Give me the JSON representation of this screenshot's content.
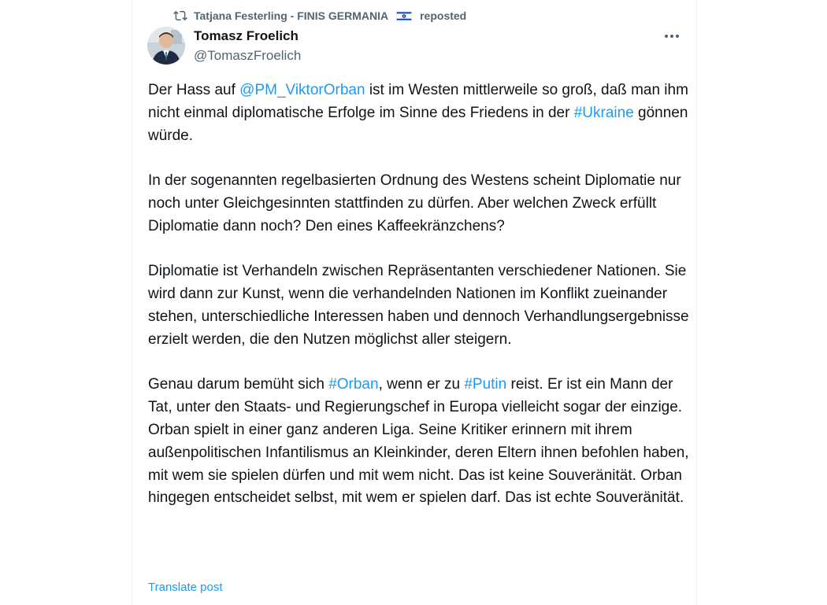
{
  "repost": {
    "user": "Tatjana Festerling - FINIS GERMANIA",
    "flag_icon": "israel-flag-icon",
    "label": "reposted"
  },
  "author": {
    "name": "Tomasz Froelich",
    "handle": "@TomaszFroelich"
  },
  "post": {
    "p1": {
      "t1": "Der Hass auf ",
      "mention": "@PM_ViktorOrban",
      "t2": " ist im Westen mittlerweile so groß, daß man ihm nicht einmal diplomatische Erfolge im Sinne des Friedens in der ",
      "hashtag": "#Ukraine",
      "t3": " gönnen würde."
    },
    "p2": "In der sogenannten regelbasierten Ordnung des Westens scheint Diplomatie nur noch unter Gleichgesinnten stattfinden zu dürfen. Aber welchen Zweck erfüllt Diplomatie dann noch? Den eines Kaffeekränzchens?",
    "p3": "Diplomatie ist Verhandeln zwischen Repräsentanten verschiedener Nationen. Sie wird dann zur Kunst, wenn die verhandelnden Nationen im Konflikt zueinander stehen, unterschiedliche Interessen haben und dennoch Verhandlungsergebnisse erzielt werden, die den Nutzen möglichst aller steigern.",
    "p4": {
      "t1": "Genau darum bemüht sich ",
      "hashtag1": "#Orban",
      "t2": ", wenn er zu ",
      "hashtag2": "#Putin",
      "t3": " reist. Er ist ein Mann der Tat, unter den Staats- und Regierungschef in Europa vielleicht sogar der einzige. Orban spielt in einer ganz anderen Liga. Seine Kritiker erinnern mit ihrem außenpolitischen Infantilismus an Kleinkinder, deren Eltern ihnen befohlen haben, mit wem sie spielen dürfen und mit wem nicht. Das ist keine Souveränität. Orban hingegen entscheidet selbst, mit wem er spielen darf. Das ist echte Souveränität."
    }
  },
  "translate_label": "Translate post",
  "colors": {
    "link": "#1d9bf0",
    "text": "#0f1419",
    "secondary": "#536471"
  }
}
